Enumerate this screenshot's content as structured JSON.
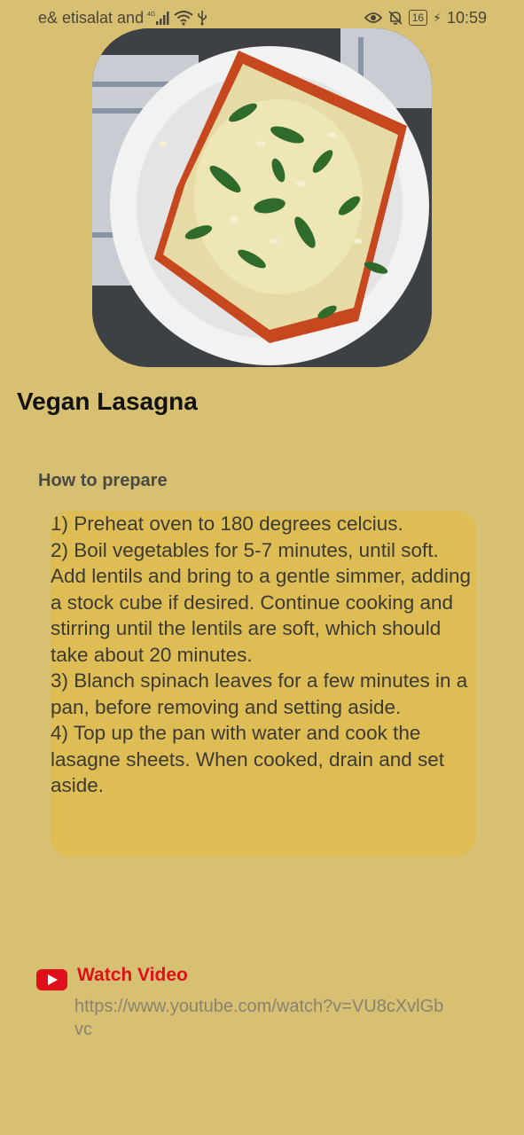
{
  "status_bar": {
    "carrier": "e& etisalat and",
    "network_badge": "4G",
    "battery_level": "16",
    "time": "10:59",
    "icons": [
      "signal-icon",
      "wifi-icon",
      "usb-icon",
      "eye-icon",
      "bell-off-icon",
      "battery-icon",
      "charging-icon"
    ]
  },
  "recipe": {
    "title": "Vegan Lasagna",
    "image": "vegan-lasagna-photo",
    "section_heading": "How to prepare",
    "instructions": "1) Preheat oven to 180 degrees celcius.\n2) Boil vegetables for 5-7 minutes, until soft. Add lentils and bring to a gentle simmer, adding a stock cube if desired. Continue cooking and stirring until the lentils are soft, which should take about 20 minutes.\n3) Blanch spinach leaves for a few minutes in a pan, before removing and setting aside.\n4) Top up the pan with water and cook the lasagne sheets. When cooked, drain and set aside."
  },
  "video": {
    "label": "Watch Video",
    "url": "https://www.youtube.com/watch?v=VU8cXvlGbvc",
    "icon": "youtube-icon"
  },
  "colors": {
    "background": "#d8c072",
    "instructions_box": "#dfbd55",
    "video_label": "#e0101b"
  }
}
